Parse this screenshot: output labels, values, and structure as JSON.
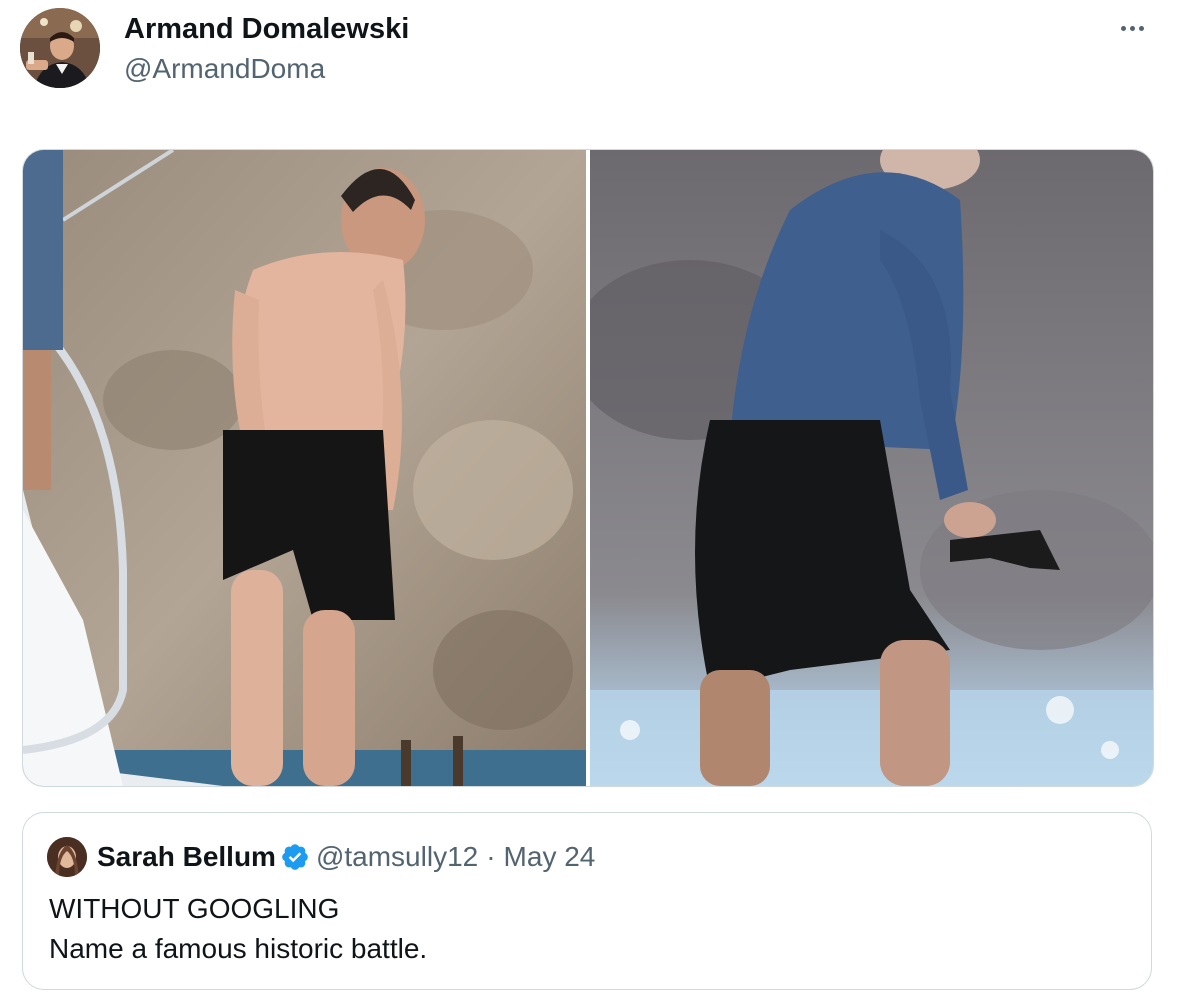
{
  "tweet": {
    "author": {
      "display_name": "Armand Domalewski",
      "handle": "@ArmandDoma",
      "avatar_icon": "profile-photo"
    },
    "more_icon": "more-options-icon",
    "media": {
      "photos": [
        {
          "icon": "photo-shirtless-man-boat-ladder"
        },
        {
          "icon": "photo-man-blue-shirt-black-shorts"
        }
      ]
    },
    "quoted_tweet": {
      "display_name": "Sarah Bellum",
      "verified_icon": "verified-badge-icon",
      "verified_color": "#1d9bf0",
      "handle": "@tamsully12",
      "separator": "·",
      "date": "May 24",
      "lines": [
        "WITHOUT GOOGLING",
        "Name a famous historic battle."
      ]
    }
  }
}
